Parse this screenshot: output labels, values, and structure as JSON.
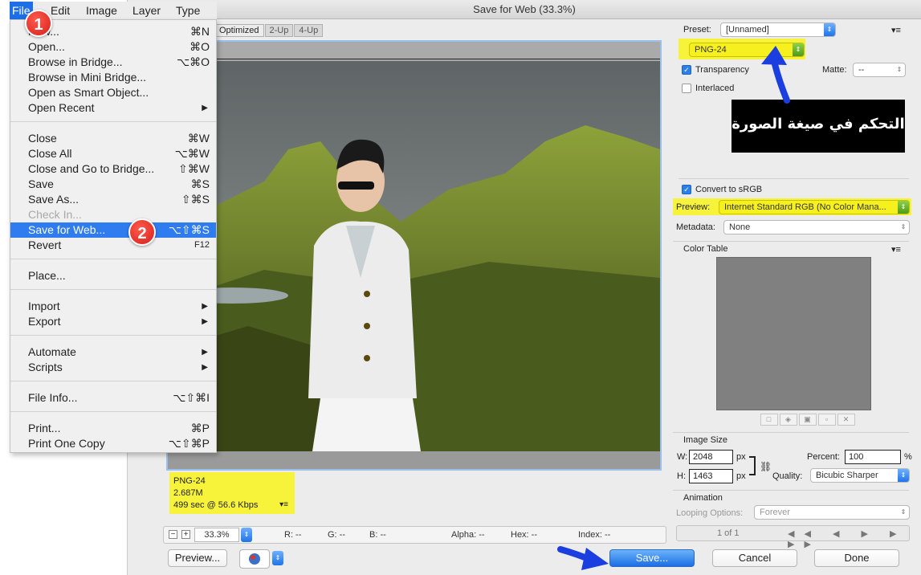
{
  "dialog": {
    "title": "Save for Web (33.3%)"
  },
  "view_tabs": [
    "Optimized",
    "2-Up",
    "4-Up"
  ],
  "image_info": {
    "format": "PNG-24",
    "size": "2.687M",
    "download": "499 sec @ 56.6 Kbps"
  },
  "statusbar": {
    "zoom": "33.3%",
    "r": "R: --",
    "g": "G: --",
    "b": "B: --",
    "alpha": "Alpha: --",
    "hex": "Hex: --",
    "index": "Index: --"
  },
  "buttons": {
    "preview": "Preview...",
    "save": "Save...",
    "cancel": "Cancel",
    "done": "Done"
  },
  "settings": {
    "preset_label": "Preset:",
    "preset_value": "[Unnamed]",
    "format_value": "PNG-24",
    "transparency_label": "Transparency",
    "transparency_checked": true,
    "interlaced_label": "Interlaced",
    "interlaced_checked": false,
    "matte_label": "Matte:",
    "matte_value": "--",
    "convert_srgb_label": "Convert to sRGB",
    "convert_srgb_checked": true,
    "preview_label": "Preview:",
    "preview_value": "Internet Standard RGB (No Color Mana...",
    "metadata_label": "Metadata:",
    "metadata_value": "None",
    "color_table_label": "Color Table"
  },
  "image_size": {
    "label": "Image Size",
    "w_label": "W:",
    "w_value": "2048",
    "h_label": "H:",
    "h_value": "1463",
    "unit": "px",
    "percent_label": "Percent:",
    "percent_value": "100",
    "percent_unit": "%",
    "quality_label": "Quality:",
    "quality_value": "Bicubic Sharper"
  },
  "animation": {
    "label": "Animation",
    "looping_label": "Looping Options:",
    "looping_value": "Forever",
    "frame": "1 of 1"
  },
  "callout": "التحكم في صيغة الصورة",
  "menubar": [
    "File",
    "Edit",
    "Image",
    "Layer",
    "Type"
  ],
  "file_menu": [
    {
      "label": "New...",
      "shortcut": "⌘N"
    },
    {
      "label": "Open...",
      "shortcut": "⌘O"
    },
    {
      "label": "Browse in Bridge...",
      "shortcut": "⌥⌘O"
    },
    {
      "label": "Browse in Mini Bridge...",
      "shortcut": ""
    },
    {
      "label": "Open as Smart Object...",
      "shortcut": ""
    },
    {
      "label": "Open Recent",
      "shortcut": "▶"
    },
    {
      "label": "Close",
      "shortcut": "⌘W"
    },
    {
      "label": "Close All",
      "shortcut": "⌥⌘W"
    },
    {
      "label": "Close and Go to Bridge...",
      "shortcut": "⇧⌘W"
    },
    {
      "label": "Save",
      "shortcut": "⌘S"
    },
    {
      "label": "Save As...",
      "shortcut": "⇧⌘S"
    },
    {
      "label": "Check In...",
      "shortcut": ""
    },
    {
      "label": "Save for Web...",
      "shortcut": "⌥⇧⌘S"
    },
    {
      "label": "Revert",
      "shortcut": "F12"
    },
    {
      "label": "Place...",
      "shortcut": ""
    },
    {
      "label": "Import",
      "shortcut": "▶"
    },
    {
      "label": "Export",
      "shortcut": "▶"
    },
    {
      "label": "Automate",
      "shortcut": "▶"
    },
    {
      "label": "Scripts",
      "shortcut": "▶"
    },
    {
      "label": "File Info...",
      "shortcut": "⌥⇧⌘I"
    },
    {
      "label": "Print...",
      "shortcut": "⌘P"
    },
    {
      "label": "Print One Copy",
      "shortcut": "⌥⇧⌘P"
    }
  ],
  "badges": [
    "1",
    "2"
  ],
  "colors": {
    "accent": "#1e6ee8",
    "highlight": "#f7f33a",
    "selected_menu": "#2e7cf0",
    "badge": "#d61f1a"
  }
}
